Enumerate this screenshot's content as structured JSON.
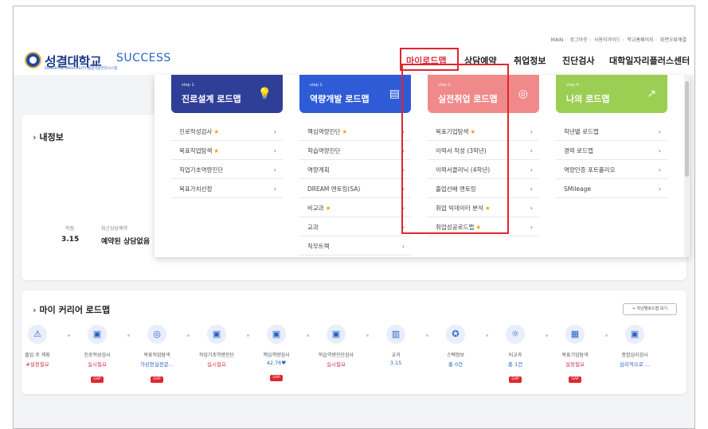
{
  "header": {
    "top_links": [
      "MAIN",
      "로그아웃",
      "사용자가이드",
      "학교홈페이지",
      "화면오류해결"
    ],
    "logo_name": "성결대학교",
    "logo_success": "SUCCESS",
    "logo_sub": "SUNGKYUL UNIVERSITY 통합역량관리시스템",
    "nav": [
      "마이로드맵",
      "상담예약",
      "취업정보",
      "진단검사",
      "대학일자리플러스센터"
    ]
  },
  "profile": {
    "title": "내정보",
    "stats": [
      {
        "label": "학점",
        "value": "3.15"
      },
      {
        "label": "최근상담예약",
        "value": "예약된 상담없음"
      }
    ]
  },
  "mega_menu": {
    "columns": [
      {
        "step": "step 1.",
        "title": "진로설계 로드맵",
        "icon": "lightbulb-icon",
        "color": "#2f3f98",
        "items": [
          {
            "label": "진로적성검사",
            "star": true
          },
          {
            "label": "목표직업탐색",
            "star": true
          },
          {
            "label": "직업기초역량진단",
            "star": false
          },
          {
            "label": "목표가치선정",
            "star": false
          }
        ]
      },
      {
        "step": "step 2.",
        "title": "역량개발 로드맵",
        "icon": "document-icon",
        "color": "#2f5bd7",
        "items": [
          {
            "label": "핵심역량진단",
            "star": true
          },
          {
            "label": "학습역량진단",
            "star": false
          },
          {
            "label": "역량계획",
            "star": false
          },
          {
            "label": "DREAM 멘토링(SA)",
            "star": false
          },
          {
            "label": "비교과",
            "star": true
          },
          {
            "label": "교과",
            "star": false
          },
          {
            "label": "직무트랙",
            "star": false
          }
        ]
      },
      {
        "step": "step 3.",
        "title": "실전취업 로드맵",
        "icon": "target-icon",
        "color": "#f08a8a",
        "items": [
          {
            "label": "목표기업탐색",
            "star": true
          },
          {
            "label": "이력서 작성 (3학년)",
            "star": false
          },
          {
            "label": "이력서클리닉 (4학년)",
            "star": false
          },
          {
            "label": "졸업선배 멘토링",
            "star": false
          },
          {
            "label": "취업 빅데이터 분석",
            "star": true
          },
          {
            "label": "취업성공로드맵",
            "star": true
          }
        ]
      },
      {
        "step": "step 4.",
        "title": "나의 로드맵",
        "icon": "trend-icon",
        "color": "#9bcf53",
        "items": [
          {
            "label": "학년별 로드맵",
            "star": false
          },
          {
            "label": "경력 로드맵",
            "star": false
          },
          {
            "label": "역량인증 포트폴리오",
            "star": false
          },
          {
            "label": "SMileage",
            "star": false
          }
        ]
      }
    ]
  },
  "roadmap": {
    "title": "마이 커리어 로드맵",
    "view_button": "+ 학년별로드맵 보기",
    "nodes": [
      {
        "label": "졸업 후 계획",
        "value": "#설정필요",
        "value_color": "#d63349",
        "gap": false,
        "icon": "triangle-icon"
      },
      {
        "label": "진로적성검사",
        "value": "실시필요",
        "value_color": "#d63349",
        "gap": true,
        "icon": "clipboard-icon"
      },
      {
        "label": "목표직업탐색",
        "value": "가상현실전문...",
        "value_color": "#2a63c2",
        "gap": true,
        "icon": "target-icon"
      },
      {
        "label": "직업기초역량진단",
        "value": "실시필요",
        "value_color": "#d63349",
        "gap": false,
        "icon": "clipboard-icon"
      },
      {
        "label": "핵심역량검사",
        "value": "42.76♥",
        "value_color": "#2a63c2",
        "gap": true,
        "icon": "clipboard-icon"
      },
      {
        "label": "학습역량진단검사",
        "value": "실시필요",
        "value_color": "#d63349",
        "gap": false,
        "icon": "clipboard-icon"
      },
      {
        "label": "교과",
        "value": "3.15",
        "value_color": "#2a63c2",
        "gap": false,
        "icon": "book-icon"
      },
      {
        "label": "스펙정보",
        "value": "총 0건",
        "value_color": "#2a63c2",
        "gap": false,
        "icon": "badge-icon"
      },
      {
        "label": "비교과",
        "value": "총 1건",
        "value_color": "#2a63c2",
        "gap": true,
        "icon": "bulb-icon"
      },
      {
        "label": "목표기업탐색",
        "value": "설정필요",
        "value_color": "#d63349",
        "gap": true,
        "icon": "building-icon"
      },
      {
        "label": "종합심리검사",
        "value": "심리적으로 ...",
        "value_color": "#2a63c2",
        "gap": false,
        "icon": "clipboard-icon"
      }
    ],
    "gap_label": "GAP"
  }
}
